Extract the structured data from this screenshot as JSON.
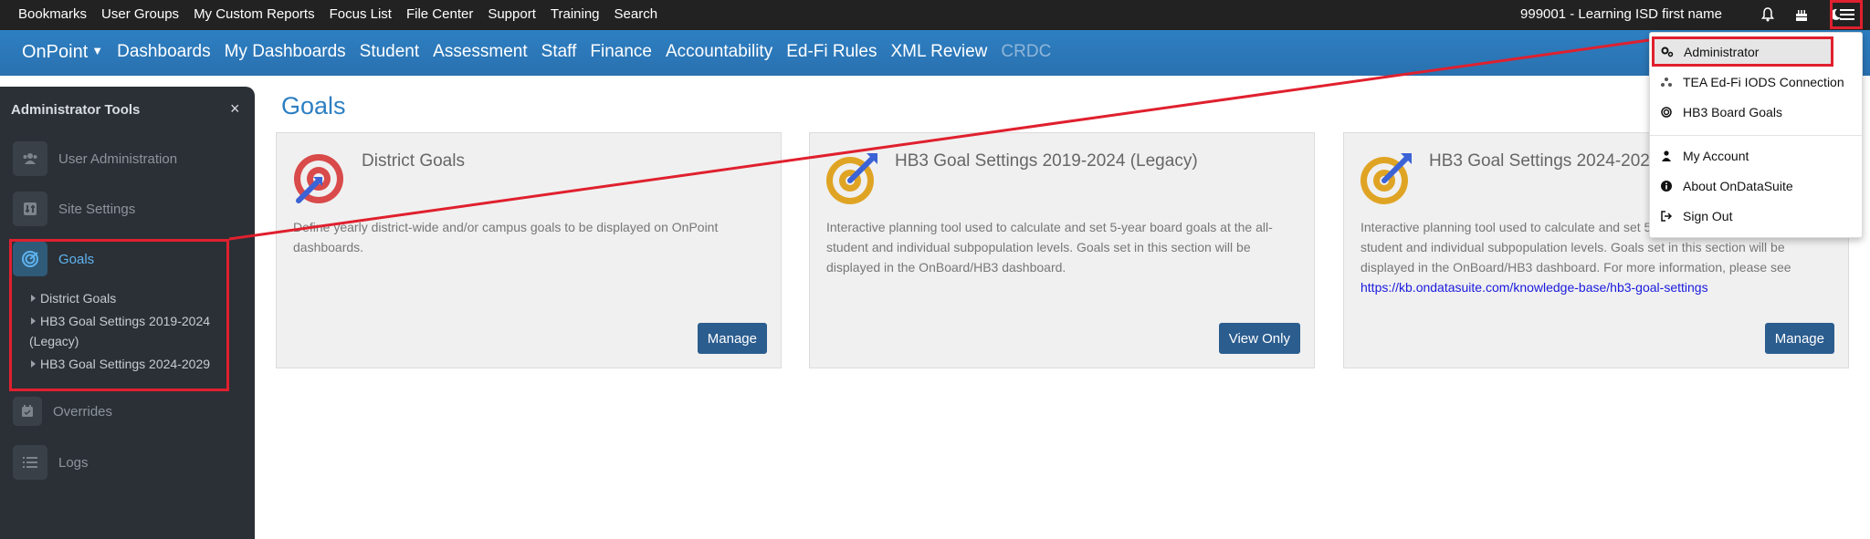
{
  "topbar": {
    "links": [
      "Bookmarks",
      "User Groups",
      "My Custom Reports",
      "Focus List",
      "File Center",
      "Support",
      "Training",
      "Search"
    ],
    "org_label": "999001 - Learning ISD first name",
    "icons": [
      "bell-icon",
      "birthday-cake-icon",
      "moon-icon",
      "hamburger-menu-icon"
    ]
  },
  "navbar": {
    "brand": "OnPoint",
    "items": [
      "Dashboards",
      "My Dashboards",
      "Student",
      "Assessment",
      "Staff",
      "Finance",
      "Accountability",
      "Ed-Fi Rules",
      "XML Review"
    ],
    "disabled_item": "CRDC"
  },
  "sidebar": {
    "title": "Administrator Tools",
    "close": "×",
    "items": [
      {
        "label": "User Administration",
        "icon": "users-icon"
      },
      {
        "label": "Site Settings",
        "icon": "settings-icon"
      },
      {
        "label": "Goals",
        "icon": "goals-icon"
      },
      {
        "label": "Overrides",
        "icon": "calendar-icon"
      },
      {
        "label": "Logs",
        "icon": "list-icon"
      }
    ],
    "sub_items": [
      "District Goals",
      "HB3 Goal Settings 2019-2024",
      "(Legacy)",
      "HB3 Goal Settings 2024-2029"
    ]
  },
  "main": {
    "title": "Goals",
    "cards": [
      {
        "title": "District Goals",
        "description": "Define yearly district-wide and/or campus goals to be displayed on OnPoint dashboards.",
        "button": "Manage",
        "icon": "target-red-icon"
      },
      {
        "title": "HB3 Goal Settings 2019-2024 (Legacy)",
        "description": "Interactive planning tool used to calculate and set 5-year board goals at the all-student and individual subpopulation levels. Goals set in this section will be displayed in the OnBoard/HB3 dashboard.",
        "button": "View Only",
        "icon": "target-gold-icon"
      },
      {
        "title": "HB3 Goal Settings 2024-2029",
        "description": "Interactive planning tool used to calculate and set 5-year board goals at the all-student and individual subpopulation levels. Goals set in this section will be displayed in the OnBoard/HB3 dashboard. For more information, please see",
        "link": "https://kb.ondatasuite.com/knowledge-base/hb3-goal-settings",
        "button": "Manage",
        "icon": "target-gold-icon"
      }
    ]
  },
  "dropdown": {
    "items": [
      {
        "label": "Administrator",
        "icon": "gears-icon"
      },
      {
        "label": "TEA Ed-Fi IODS Connection",
        "icon": "network-icon"
      },
      {
        "label": "HB3 Board Goals",
        "icon": "bullseye-icon"
      },
      {
        "label": "My Account",
        "icon": "user-icon"
      },
      {
        "label": "About OnDataSuite",
        "icon": "info-icon"
      },
      {
        "label": "Sign Out",
        "icon": "sign-out-icon"
      }
    ]
  },
  "colors": {
    "topbar": "#222222",
    "navbar": "#2d7fc2",
    "sidebar": "#2b3036",
    "button": "#2b5d8f",
    "annotation": "#e0202e"
  }
}
